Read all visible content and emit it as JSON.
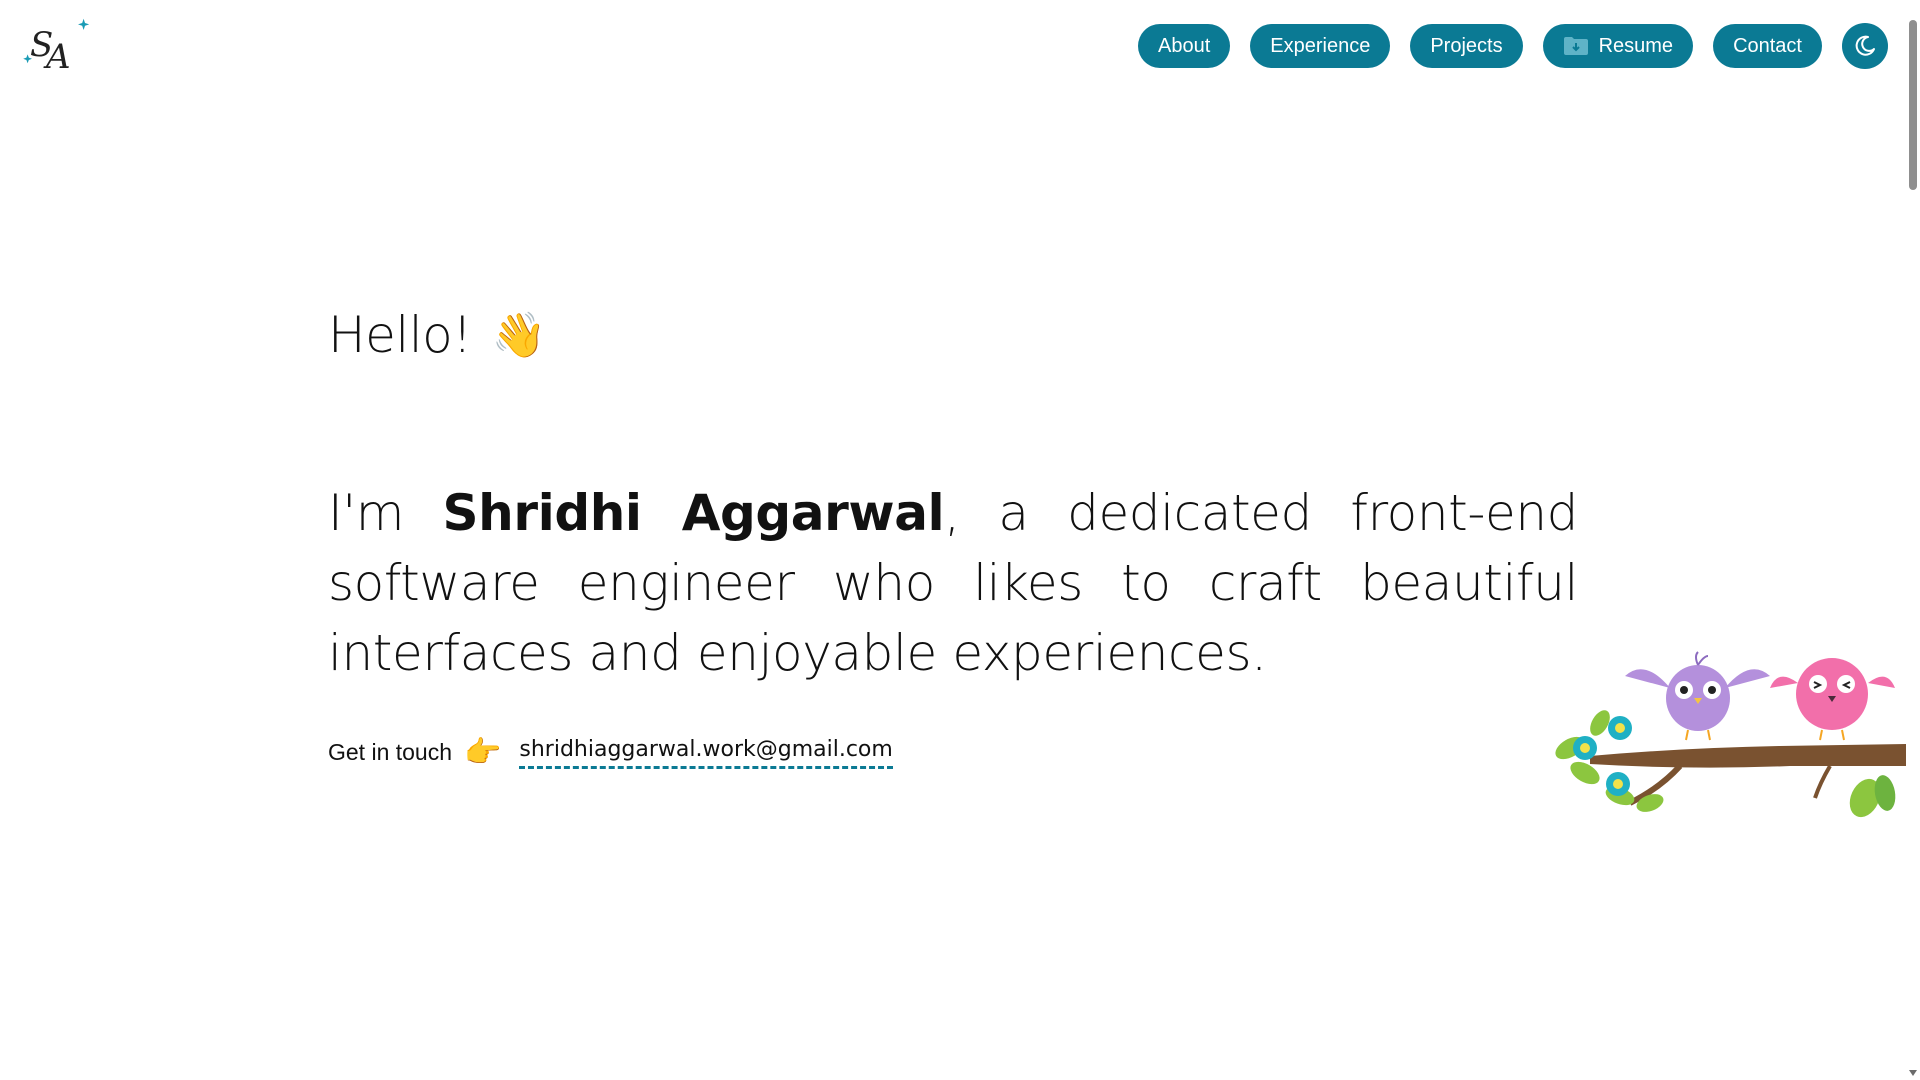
{
  "header": {
    "logo_text": "SA",
    "nav": {
      "about_label": "About",
      "experience_label": "Experience",
      "projects_label": "Projects",
      "resume_label": "Resume",
      "contact_label": "Contact"
    },
    "theme_toggle_icon": "moon-icon",
    "resume_icon": "folder-download-icon"
  },
  "hero": {
    "greeting": "Hello!",
    "greeting_emoji": "👋",
    "intro_prefix": "I'm ",
    "name": "Shridhi Aggarwal",
    "intro_suffix": ", a dedicated front-end software engineer who likes to craft beautiful interfaces and enjoyable experiences.",
    "contact_label": "Get in touch",
    "contact_emoji": "👉",
    "email": "shridhiaggarwal.work@gmail.com"
  },
  "colors": {
    "accent": "#0b7a94",
    "text": "#111111",
    "background": "#ffffff"
  }
}
